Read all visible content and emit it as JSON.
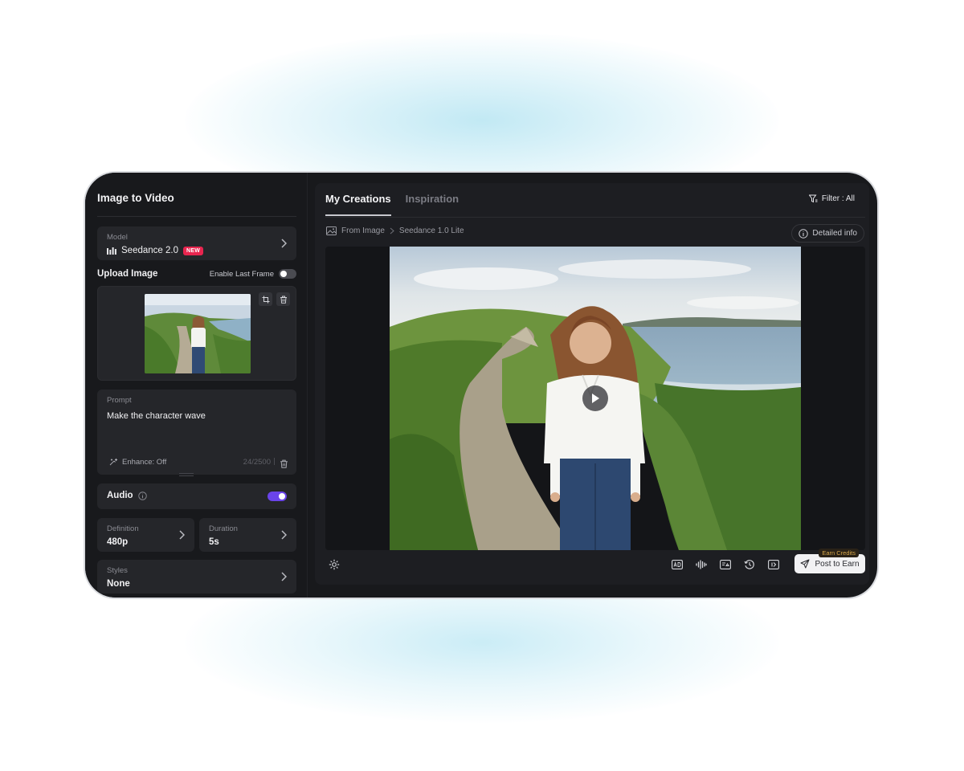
{
  "sidebar": {
    "title": "Image to Video",
    "model": {
      "label": "Model",
      "name": "Seedance 2.0",
      "badge": "NEW"
    },
    "upload": {
      "label": "Upload Image",
      "last_frame_label": "Enable Last Frame",
      "last_frame_enabled": false
    },
    "prompt": {
      "label": "Prompt",
      "text": "Make the character wave",
      "enhance_label": "Enhance: Off",
      "char_count": "24/2500"
    },
    "audio": {
      "label": "Audio",
      "enabled": true
    },
    "definition": {
      "label": "Definition",
      "value": "480p"
    },
    "duration": {
      "label": "Duration",
      "value": "5s"
    },
    "styles": {
      "label": "Styles",
      "value": "None"
    }
  },
  "main": {
    "tabs": [
      {
        "label": "My Creations",
        "active": true
      },
      {
        "label": "Inspiration",
        "active": false
      }
    ],
    "filter_label": "Filter : All",
    "breadcrumb": {
      "source": "From Image",
      "model": "Seedance 1.0 Lite"
    },
    "detail_label": "Detailed info",
    "post_label": "Post to Earn",
    "earn_tag": "Earn Credits"
  },
  "colors": {
    "accent": "#6a44ea",
    "badge": "#e8254f",
    "panel": "#18191c",
    "card": "#25262a"
  },
  "icons": [
    "bars-icon",
    "chevron-right-icon",
    "crop-icon",
    "trash-icon",
    "enhance-icon",
    "info-icon",
    "filter-icon",
    "image-icon",
    "play-icon",
    "settings-icon",
    "ad-icon",
    "waveform-icon",
    "compare-icon",
    "history-icon",
    "extend-icon",
    "send-icon"
  ]
}
